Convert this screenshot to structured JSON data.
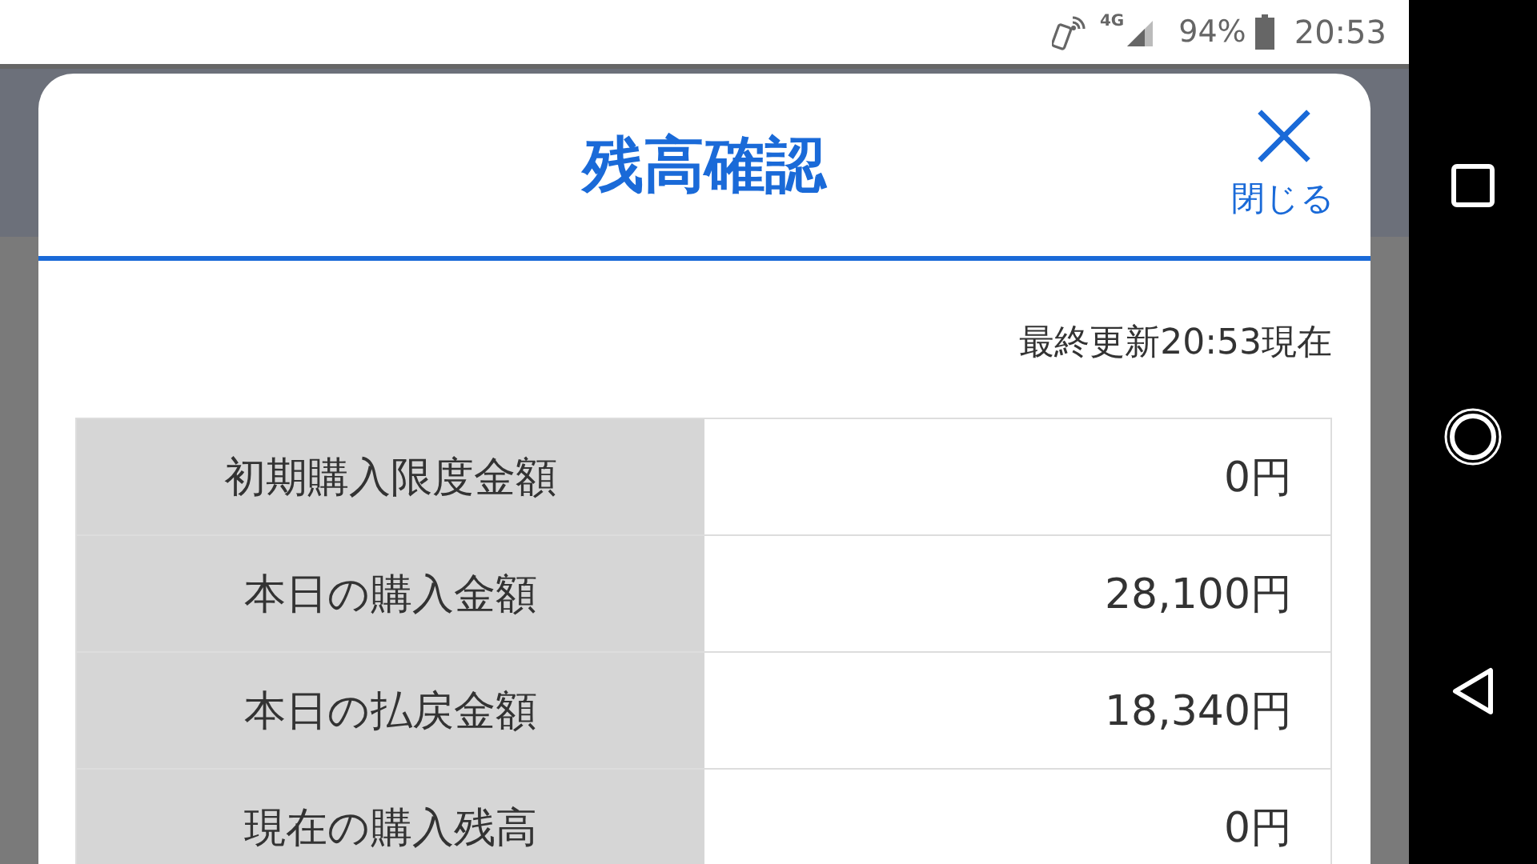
{
  "status_bar": {
    "network": "4G",
    "battery": "94%",
    "time": "20:53"
  },
  "dialog": {
    "title": "残高確認",
    "close_label": "閉じる",
    "updated": "最終更新20:53現在",
    "rows": [
      {
        "label": "初期購入限度金額",
        "value": "0円"
      },
      {
        "label": "本日の購入金額",
        "value": "28,100円"
      },
      {
        "label": "本日の払戻金額",
        "value": "18,340円"
      },
      {
        "label": "現在の購入残高",
        "value": "0円"
      }
    ]
  }
}
